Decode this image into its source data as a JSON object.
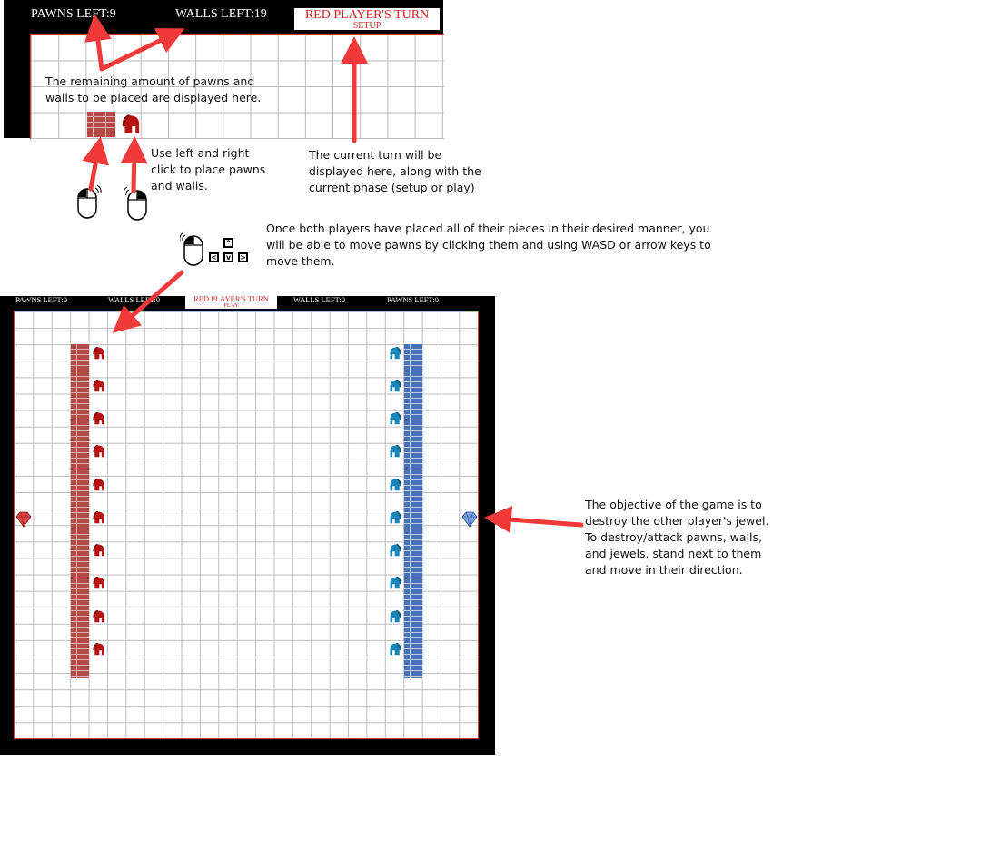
{
  "setup_hud": {
    "pawns_left": "PAWNS LEFT:9",
    "walls_left": "WALLS LEFT:19",
    "turn": "RED PLAYER'S TURN",
    "phase": "SETUP"
  },
  "play_hud": {
    "pawns_left_red": "PAWNS LEFT:0",
    "walls_left_red": "WALLS LEFT:0",
    "turn": "RED PLAYER'S TURN",
    "phase": "PLAY",
    "walls_left_blue": "WALLS LEFT:0",
    "pawns_left_blue": "PAWNS LEFT:0"
  },
  "annotations": {
    "remaining": [
      "The remaining amount of pawns and",
      "walls to be placed are displayed here."
    ],
    "click": [
      "Use left and right",
      "click to place pawns",
      "and walls."
    ],
    "turn": [
      "The current turn will be",
      "displayed here, along with the",
      "current phase (setup or play)"
    ],
    "move": [
      "Once both players have placed all of their pieces in their desired manner, you",
      "will be able to move pawns by clicking them and using WASD or arrow keys to",
      "move them."
    ],
    "objective": [
      "The objective of the game is to",
      "destroy the other player's jewel.",
      "To destroy/attack pawns, walls,",
      "and jewels, stand next to them",
      "and move in their direction."
    ]
  },
  "keys": {
    "up": "^",
    "left": "<",
    "down": "v",
    "right": ">"
  },
  "icons": {
    "red_pawn": "spartan-helmet-icon",
    "blue_pawn": "spartan-helmet-icon",
    "red_jewel": "diamond-icon",
    "blue_jewel": "diamond-icon",
    "mouse": "mouse-icon"
  },
  "colors": {
    "red_team": "#b81414",
    "blue_team": "#1a86b8",
    "red_wall": "#b24a48",
    "blue_wall": "#4a70b8",
    "arrow": "#f03a3a",
    "board_border": "#d94040"
  }
}
